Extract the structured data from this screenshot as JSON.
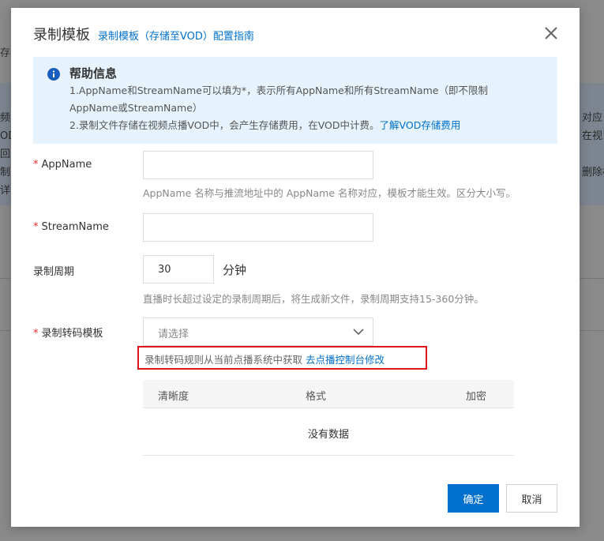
{
  "background": {
    "tab_fragment": "存",
    "left_fragments": [
      "频",
      "OD",
      "回",
      "制",
      "详"
    ],
    "right_fragments": [
      "对应",
      "在视",
      "",
      "删除模"
    ]
  },
  "dialog": {
    "title": "录制模板",
    "guide_link": "录制模板（存储至VOD）配置指南",
    "close_icon": "close-icon"
  },
  "help": {
    "icon": "info-icon",
    "title": "帮助信息",
    "line1": "1.AppName和StreamName可以填为*，表示所有AppName和所有StreamName（即不限制",
    "line1b": "AppName或StreamName）",
    "line2": "2.录制文件存储在视频点播VOD中，会产生存储费用，在VOD中计费。",
    "line2_link": "了解VOD存储费用"
  },
  "form": {
    "required_mark": "*",
    "appname": {
      "label": "AppName",
      "value": "",
      "hint": "AppName 名称与推流地址中的 AppName 名称对应，模板才能生效。区分大小写。"
    },
    "streamname": {
      "label": "StreamName",
      "value": ""
    },
    "period": {
      "label": "录制周期",
      "value": "30",
      "unit": "分钟",
      "hint": "直播时长超过设定的录制周期后，将生成新文件，录制周期支持15-360分钟。"
    },
    "transcode": {
      "label": "录制转码模板",
      "placeholder": "请选择",
      "rule_text": "录制转码规则从当前点播系统中获取",
      "rule_link": "去点播控制台修改"
    }
  },
  "table": {
    "columns": [
      "清晰度",
      "格式",
      "加密"
    ],
    "empty_text": "没有数据"
  },
  "buttons": {
    "ok": "确定",
    "cancel": "取消"
  },
  "colors": {
    "accent": "#0070cc",
    "help_bg": "#e6f3fd",
    "required": "#e62e2e",
    "highlight_border": "#e0151b"
  }
}
